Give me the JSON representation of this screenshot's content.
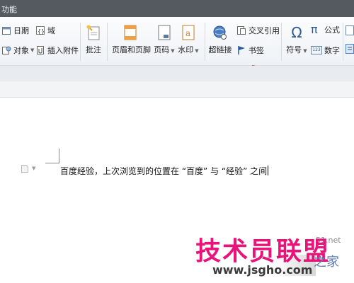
{
  "titlebar": {
    "title": "功能"
  },
  "ribbon": {
    "date_label": "日期",
    "field_label": "域",
    "object_label": "对象",
    "attachment_label": "插入附件",
    "comment_label": "批注",
    "header_footer_label": "页眉和页脚",
    "page_number_label": "页码",
    "watermark_label": "水印",
    "hyperlink_label": "超链接",
    "cross_reference_label": "交叉引用",
    "bookmark_label": "书签",
    "symbol_label": "符号",
    "formula_label": "公式",
    "number_label": "数字",
    "number_icon_text": "123",
    "symbol_icon_text": "Ω",
    "formula_icon_text": "π"
  },
  "document": {
    "text": "百度经验，上次浏览到的位置在 “百度” 与 “经验” 之间"
  },
  "watermark": {
    "main": "技术员联盟",
    "url": "www.jsgho.com",
    "side": "51.net",
    "home": "之家"
  },
  "colors": {
    "titlebar": "#555a60",
    "ribbon": "#eef2f6",
    "watermark_pink": "#e8147a",
    "arrow_red": "#d9302c"
  }
}
